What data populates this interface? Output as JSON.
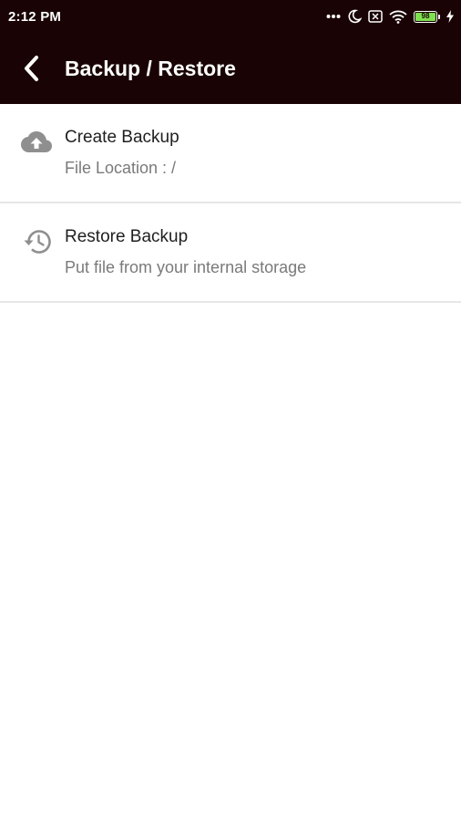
{
  "status_bar": {
    "time": "2:12 PM",
    "icons": [
      "more-dots-icon",
      "moon-icon",
      "sim-off-icon",
      "wifi-icon",
      "battery-icon",
      "charging-bolt-icon"
    ],
    "battery_level": "98"
  },
  "app_bar": {
    "title": "Backup / Restore",
    "background": "#1a0304"
  },
  "items": [
    {
      "icon": "cloud-upload-icon",
      "title": "Create Backup",
      "subtitle": "File Location : /"
    },
    {
      "icon": "history-icon",
      "title": "Restore Backup",
      "subtitle": "Put file from your internal storage"
    }
  ]
}
